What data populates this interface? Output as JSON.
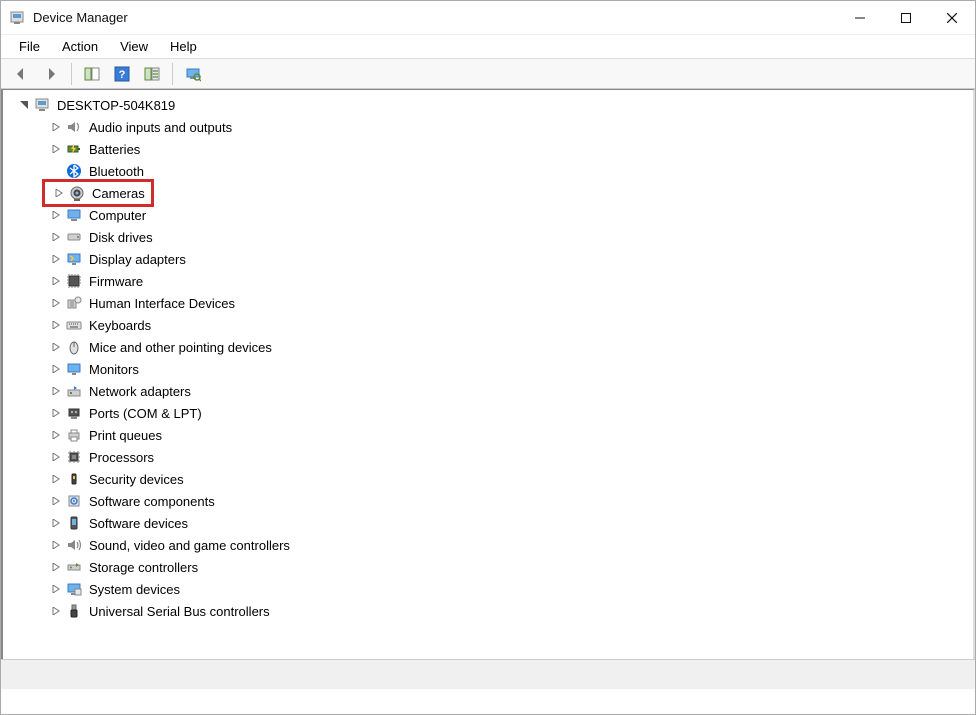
{
  "window": {
    "title": "Device Manager"
  },
  "menubar": {
    "file": "File",
    "action": "Action",
    "view": "View",
    "help": "Help"
  },
  "tree": {
    "root": "DESKTOP-504K819",
    "items": [
      {
        "label": "Audio inputs and outputs",
        "icon": "speaker"
      },
      {
        "label": "Batteries",
        "icon": "battery"
      },
      {
        "label": "Bluetooth",
        "icon": "bluetooth",
        "noExpander": true
      },
      {
        "label": "Cameras",
        "icon": "camera",
        "highlight": true
      },
      {
        "label": "Computer",
        "icon": "computer"
      },
      {
        "label": "Disk drives",
        "icon": "disk"
      },
      {
        "label": "Display adapters",
        "icon": "display"
      },
      {
        "label": "Firmware",
        "icon": "firmware"
      },
      {
        "label": "Human Interface Devices",
        "icon": "hid"
      },
      {
        "label": "Keyboards",
        "icon": "keyboard"
      },
      {
        "label": "Mice and other pointing devices",
        "icon": "mouse"
      },
      {
        "label": "Monitors",
        "icon": "monitor"
      },
      {
        "label": "Network adapters",
        "icon": "network"
      },
      {
        "label": "Ports (COM & LPT)",
        "icon": "port"
      },
      {
        "label": "Print queues",
        "icon": "printer"
      },
      {
        "label": "Processors",
        "icon": "cpu"
      },
      {
        "label": "Security devices",
        "icon": "security"
      },
      {
        "label": "Software components",
        "icon": "swcomp"
      },
      {
        "label": "Software devices",
        "icon": "swdev"
      },
      {
        "label": "Sound, video and game controllers",
        "icon": "sound"
      },
      {
        "label": "Storage controllers",
        "icon": "storage"
      },
      {
        "label": "System devices",
        "icon": "system"
      },
      {
        "label": "Universal Serial Bus controllers",
        "icon": "usb"
      }
    ]
  }
}
